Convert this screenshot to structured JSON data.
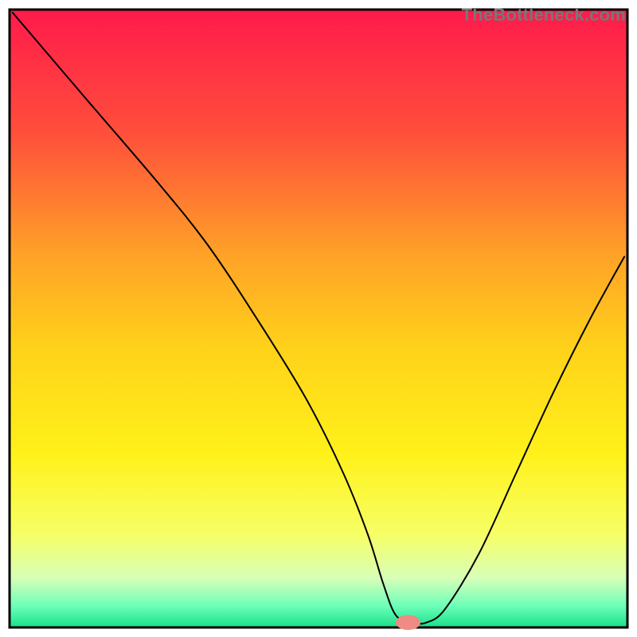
{
  "watermark": "TheBottleneck.com",
  "chart_data": {
    "type": "line",
    "title": "",
    "xlabel": "",
    "ylabel": "",
    "xlim": [
      0,
      100
    ],
    "ylim": [
      0,
      100
    ],
    "background": {
      "type": "vertical-gradient",
      "stops": [
        {
          "pos": 0.0,
          "color": "#ff1a4b"
        },
        {
          "pos": 0.2,
          "color": "#ff4f3b"
        },
        {
          "pos": 0.4,
          "color": "#ffa327"
        },
        {
          "pos": 0.55,
          "color": "#ffd21a"
        },
        {
          "pos": 0.72,
          "color": "#fff11a"
        },
        {
          "pos": 0.85,
          "color": "#f6ff66"
        },
        {
          "pos": 0.92,
          "color": "#d8ffb8"
        },
        {
          "pos": 0.965,
          "color": "#6dffb8"
        },
        {
          "pos": 1.0,
          "color": "#18e08a"
        }
      ]
    },
    "marker": {
      "x": 64.5,
      "y": 0.8,
      "color": "#ef8a84",
      "rx": 2.0,
      "ry": 1.2
    },
    "series": [
      {
        "name": "bottleneck-curve",
        "stroke": "#000000",
        "stroke_width": 2,
        "x": [
          0.5,
          12,
          24,
          32,
          40,
          48,
          54,
          58,
          60.5,
          62.5,
          65,
          67.5,
          70.5,
          76,
          82,
          88,
          94,
          99.5
        ],
        "y": [
          99.5,
          86,
          72,
          62,
          50,
          37,
          25,
          15,
          7,
          2,
          0.8,
          0.8,
          3,
          12,
          25,
          38,
          50,
          60
        ]
      }
    ],
    "frame": {
      "stroke": "#000000",
      "stroke_width": 3
    }
  }
}
